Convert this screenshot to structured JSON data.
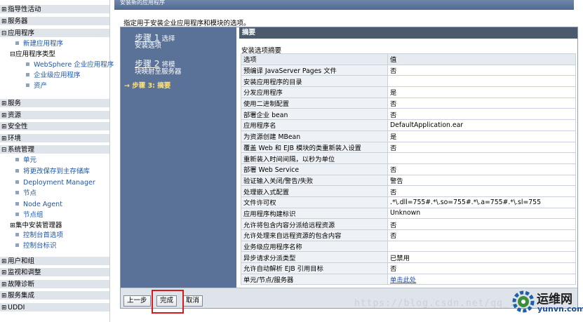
{
  "nav": {
    "categories_top": [
      {
        "sign": "⊞",
        "label": "指导性活动"
      },
      {
        "sign": "⊞",
        "label": "服务器"
      },
      {
        "sign": "⊟",
        "label": "应用程序"
      }
    ],
    "app_items": {
      "new_app": "新建应用程序",
      "app_types": "应用程序类型",
      "websphere": "WebSphere 企业应用程序",
      "business": "企业级应用程序",
      "assets": "资产"
    },
    "categories_mid": [
      {
        "sign": "⊞",
        "label": "服务"
      },
      {
        "sign": "⊞",
        "label": "资源"
      },
      {
        "sign": "⊞",
        "label": "安全性"
      },
      {
        "sign": "⊞",
        "label": "环境"
      },
      {
        "sign": "⊟",
        "label": "系统管理"
      }
    ],
    "sys_items": {
      "cell": "单元",
      "save_changes": "将更改保存到主存储库",
      "dmgr": "Deployment Manager",
      "nodes": "节点",
      "node_agent": "Node Agent",
      "node_groups": "节点组",
      "central": "集中安装管理器",
      "console_prefs": "控制台首选项",
      "console_id": "控制台标识"
    },
    "categories_bottom": [
      {
        "sign": "⊞",
        "label": "用户和组"
      },
      {
        "sign": "⊞",
        "label": "监视和调整"
      },
      {
        "sign": "⊞",
        "label": "故障诊断"
      },
      {
        "sign": "⊞",
        "label": "服务集成"
      },
      {
        "sign": "⊞",
        "label": "UDDI"
      }
    ]
  },
  "window": {
    "title": "安装新的应用程序",
    "intro": "指定用于安装企业应用程序和模块的选项。"
  },
  "steps": {
    "step1_num": "步骤 1",
    "step1_label": "选择",
    "step1_label2": "安装选项",
    "step2_num": "步骤 2",
    "step2_label": "将模",
    "step2_label2": "块映射至服务器",
    "step3": "→ 步骤 3: 摘要"
  },
  "summary": {
    "heading": "摘要",
    "subheading": "安装选项摘要",
    "col_option": "选项",
    "col_value": "值",
    "rows": [
      {
        "option": "预编译 JavaServer Pages 文件",
        "value": "否"
      },
      {
        "option": "安装应用程序的目录",
        "value": ""
      },
      {
        "option": "分发应用程序",
        "value": "是"
      },
      {
        "option": "使用二进制配置",
        "value": "否"
      },
      {
        "option": "部署企业 bean",
        "value": "否"
      },
      {
        "option": "应用程序名",
        "value": "DefaultApplication.ear"
      },
      {
        "option": "为资源创建 MBean",
        "value": "是"
      },
      {
        "option": "覆盖 Web 和 EJB 模块的类重新装入设置",
        "value": "否"
      },
      {
        "option": "重新装入时间间隔，以秒为单位",
        "value": ""
      },
      {
        "option": "部署 Web Service",
        "value": "否"
      },
      {
        "option": "验证输入关闭/警告/失败",
        "value": "警告"
      },
      {
        "option": "处理嵌入式配置",
        "value": "否"
      },
      {
        "option": "文件许可权",
        "value": ".*\\.dll=755#.*\\.so=755#.*\\.a=755#.*\\.sl=755"
      },
      {
        "option": "应用程序构建标识",
        "value": "Unknown"
      },
      {
        "option": "允许将包含内容分派给远程资源",
        "value": "否"
      },
      {
        "option": "允许处理来自远程资源的包含内容",
        "value": "否"
      },
      {
        "option": "业务级应用程序名称",
        "value": ""
      },
      {
        "option": "异步请求分派类型",
        "value": "已禁用"
      },
      {
        "option": "允许自动解析 EJB 引用目标",
        "value": "否"
      },
      {
        "option": "单元/节点/服务器",
        "value": "单击此处",
        "link": true
      }
    ]
  },
  "buttons": {
    "previous": "上一步",
    "finish": "完成",
    "cancel": "取消"
  },
  "watermark": {
    "url": "https://blog.csdn.net/qq_...",
    "brand": "运维网",
    "site": "yunvn.com"
  },
  "colors": {
    "highlight": "#d71920",
    "step_panel": "#5a7298",
    "summary_head": "#4c5a6e"
  }
}
